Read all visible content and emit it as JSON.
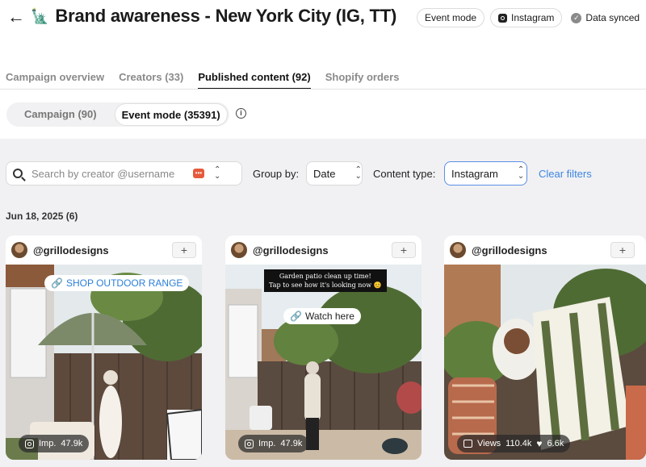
{
  "header": {
    "back_label": "←",
    "title_emoji": "🗽",
    "title": "Brand awareness - New York City (IG, TT)",
    "chips": {
      "event_mode": "Event mode",
      "instagram": "Instagram",
      "synced": "Data synced"
    }
  },
  "tabs": [
    {
      "label": "Campaign overview",
      "active": false
    },
    {
      "label": "Creators (33)",
      "active": false
    },
    {
      "label": "Published content (92)",
      "active": true
    },
    {
      "label": "Shopify orders",
      "active": false
    }
  ],
  "segment": {
    "campaign": "Campaign (90)",
    "event_mode": "Event mode (35391)",
    "info": "i"
  },
  "filters": {
    "search_placeholder": "Search by creator @username",
    "group_by_label": "Group by:",
    "group_by_value": "Date",
    "content_type_label": "Content type:",
    "content_type_value": "Instagram",
    "clear_label": "Clear filters"
  },
  "date_group": "Jun 18, 2025 (6)",
  "cards": [
    {
      "handle": "@grillodesigns",
      "plus": "+",
      "overlay_link": "SHOP OUTDOOR RANGE",
      "stat_label": "Imp.",
      "stat_value": "47.9k"
    },
    {
      "handle": "@grillodesigns",
      "plus": "+",
      "note_line1": "Garden patio clean up time!",
      "note_line2": "Tap to see how it's looking now 😊",
      "overlay_link": "Watch here",
      "stat_label": "Imp.",
      "stat_value": "47.9k"
    },
    {
      "handle": "@grillodesigns",
      "plus": "+",
      "stat_label": "Views",
      "stat_value": "110.4k",
      "likes_value": "6.6k"
    }
  ],
  "colors": {
    "accent_blue": "#3d86e0",
    "foliage": "#4f6b34",
    "sky": "#dfe6ea"
  }
}
